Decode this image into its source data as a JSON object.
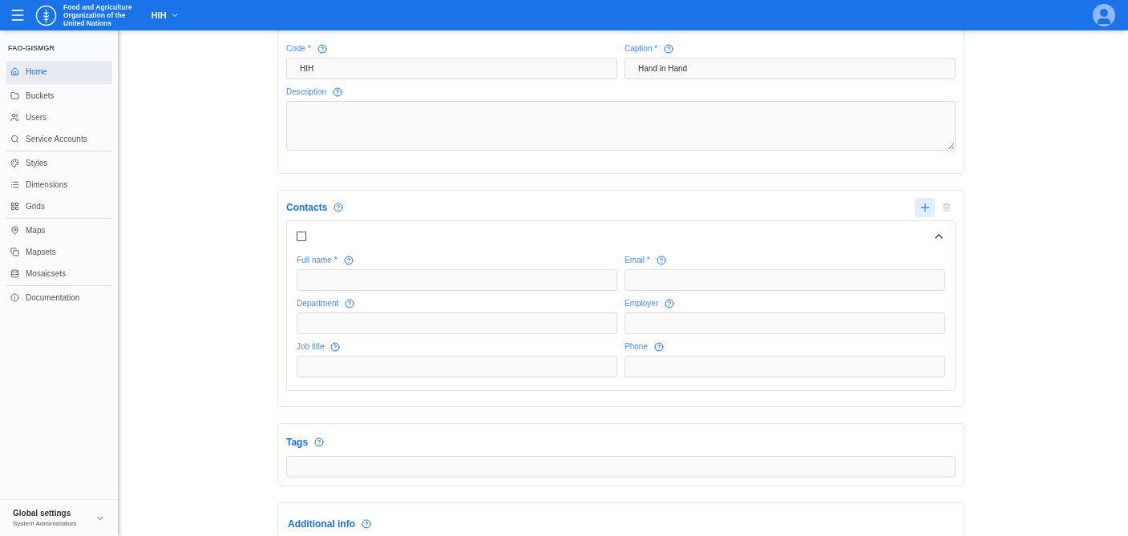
{
  "header": {
    "org_lines": [
      "Food and Agriculture",
      "Organization of the",
      "United Nations"
    ],
    "workspace": "HIH"
  },
  "sidebar": {
    "title": "FAO-GISMGR",
    "groups": [
      {
        "items": [
          {
            "label": "Home",
            "selected": true
          }
        ]
      },
      {
        "items": [
          {
            "label": "Buckets",
            "selected": false
          },
          {
            "label": "Users",
            "selected": false
          },
          {
            "label": "Service Accounts",
            "selected": false
          }
        ]
      },
      {
        "items": [
          {
            "label": "Styles",
            "selected": false
          },
          {
            "label": "Dimensions",
            "selected": false
          },
          {
            "label": "Grids",
            "selected": false
          }
        ]
      },
      {
        "items": [
          {
            "label": "Maps",
            "selected": false
          },
          {
            "label": "Mapsets",
            "selected": false
          },
          {
            "label": "Mosaicsets",
            "selected": false
          }
        ]
      },
      {
        "items": [
          {
            "label": "Documentation",
            "selected": false
          }
        ]
      }
    ],
    "footer": {
      "title": "Global settings",
      "subtitle": "System Administrators"
    }
  },
  "general_info": {
    "fields": [
      {
        "label": "Code *",
        "value": "HIH",
        "kind": "input"
      },
      {
        "label": "Caption *",
        "value": "Hand in Hand",
        "kind": "input"
      },
      {
        "label": "Description",
        "kind": "textarea"
      }
    ]
  },
  "contacts": {
    "title": "Contacts",
    "items": [
      {
        "checked": false,
        "expanded": true,
        "fields": [
          {
            "label": "Full name *"
          },
          {
            "label": "Email *"
          },
          {
            "label": "Department"
          },
          {
            "label": "Employer"
          },
          {
            "label": "Job title"
          },
          {
            "label": "Phone"
          }
        ]
      }
    ]
  },
  "tags": {
    "title": "Tags"
  },
  "additional_info": {
    "title": "Additional info"
  }
}
